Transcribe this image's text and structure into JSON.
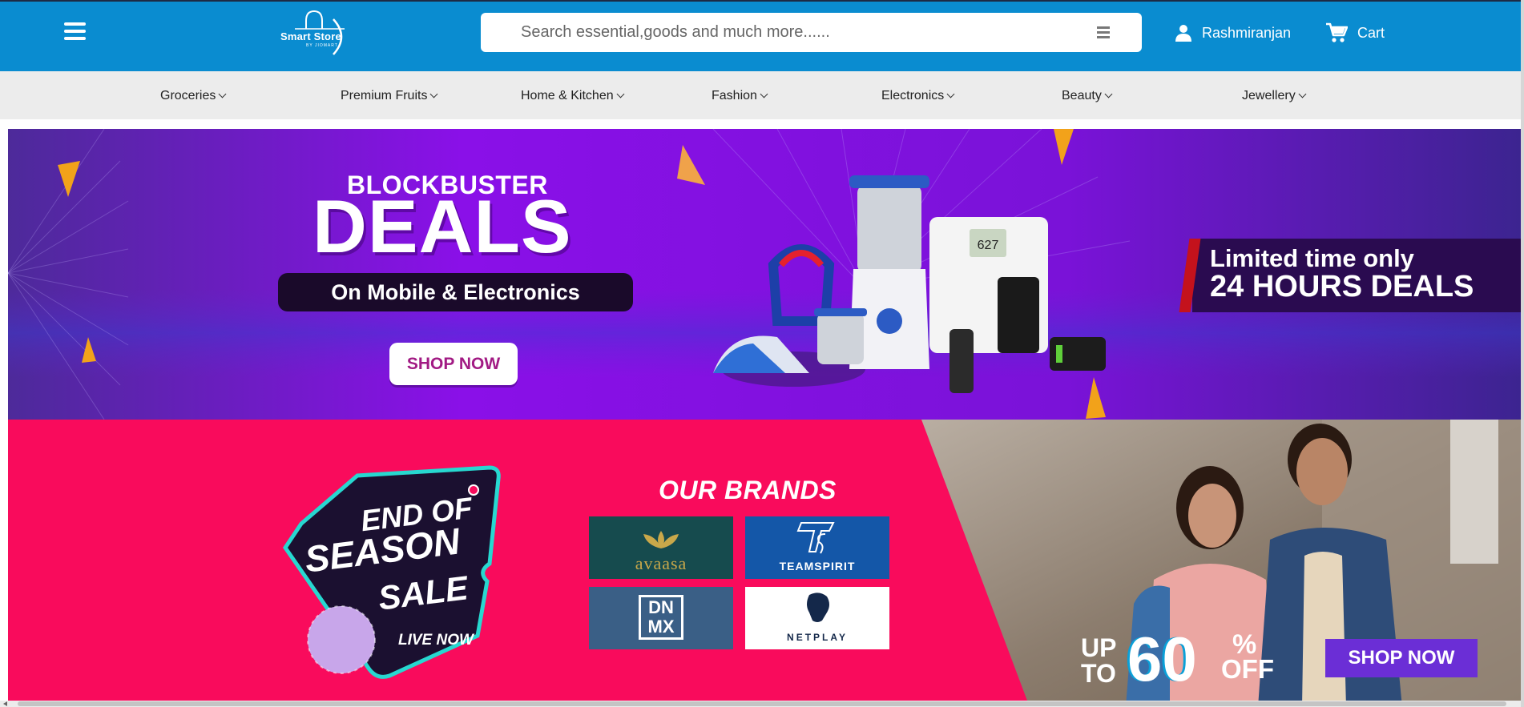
{
  "header": {
    "menu_icon": "hamburger-menu-icon",
    "logo": {
      "text": "Smart Store",
      "subtext": "BY JIOMART"
    },
    "search": {
      "placeholder": "Search essential,goods and much more......",
      "value": "",
      "filter_icon": "menu-lines-icon"
    },
    "user": {
      "name": "Rashmiranjan",
      "icon": "user-icon"
    },
    "cart": {
      "label": "Cart",
      "icon": "cart-icon"
    },
    "colors": {
      "bar": "#0a8cd0"
    }
  },
  "nav": {
    "items": [
      {
        "label": "Groceries"
      },
      {
        "label": "Premium Fruits"
      },
      {
        "label": "Home & Kitchen"
      },
      {
        "label": "Fashion"
      },
      {
        "label": "Electronics"
      },
      {
        "label": "Beauty"
      },
      {
        "label": "Jewellery"
      }
    ]
  },
  "banner1": {
    "title_line1": "BLOCKBUSTER",
    "title_line2": "DEALS",
    "subtitle": "On Mobile & Electronics",
    "button": "SHOP NOW",
    "right_line1": "Limited time only",
    "right_line2": "24 HOURS DEALS",
    "product_display": "627",
    "colors": {
      "background": "#7d12e0",
      "button_text": "#a21b84"
    }
  },
  "banner2": {
    "sale_line1": "END OF",
    "sale_line2": "SEASON",
    "sale_line3": "SALE",
    "sale_live": "LIVE NOW",
    "brands_title": "OUR BRANDS",
    "brands": [
      {
        "name": "avaasa"
      },
      {
        "name": "TEAMSPIRIT"
      },
      {
        "name": "DN MX"
      },
      {
        "name": "NETPLAY"
      }
    ],
    "offer_upto_1": "UP",
    "offer_upto_2": "TO",
    "offer_pct": "60",
    "offer_pct_sign": "%",
    "offer_off": "OFF",
    "button": "SHOP NOW",
    "colors": {
      "background": "#f90b5c",
      "button": "#6b2ed6"
    }
  }
}
